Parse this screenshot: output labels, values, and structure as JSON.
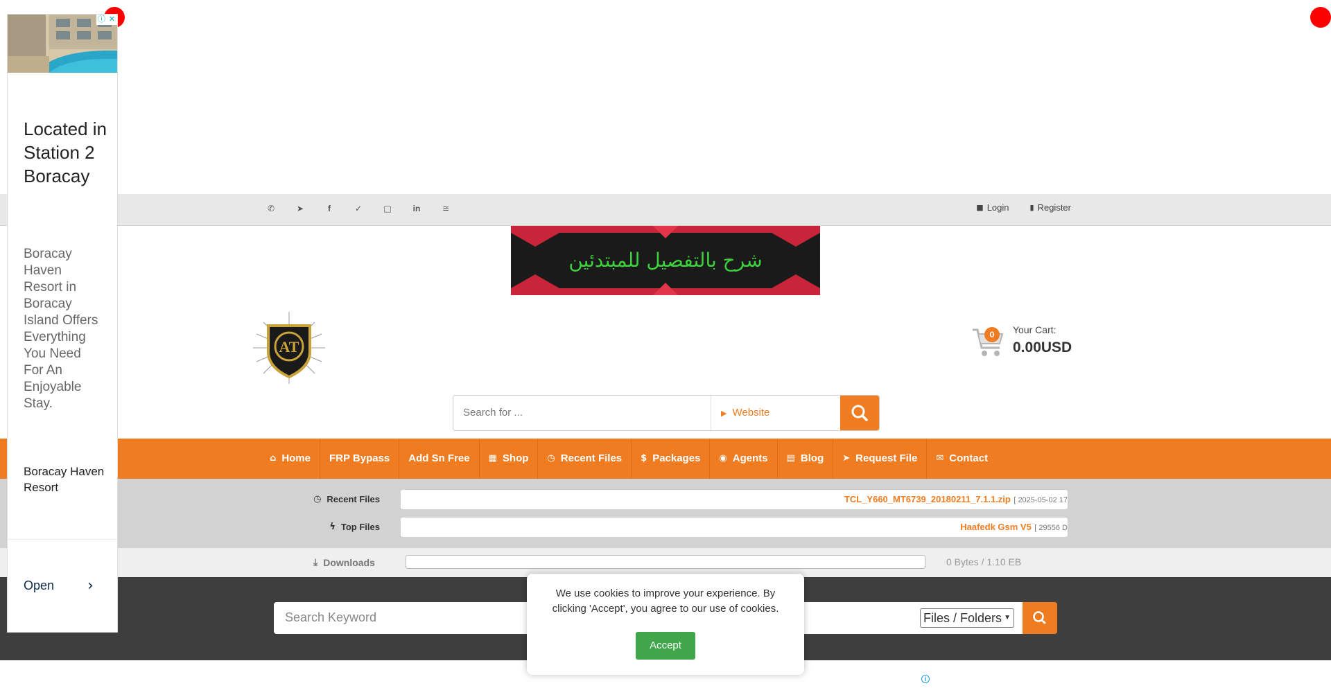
{
  "side_ad": {
    "title": "Located in Station 2 Boracay",
    "description": "Boracay Haven Resort in Boracay Island Offers Everything You Need For An Enjoyable Stay.",
    "brand": "Boracay Haven Resort",
    "cta": "Open",
    "adchoices_icon": "info-icon",
    "close_icon": "close-icon",
    "chevron_icon": "chevron-right-icon"
  },
  "topbar": {
    "social_icons": [
      "whatsapp-icon",
      "telegram-icon",
      "facebook-icon",
      "twitter-icon",
      "instagram-icon",
      "linkedin-icon",
      "rss-icon"
    ],
    "login": "Login",
    "register": "Register"
  },
  "banner": {
    "text": "شرح بالتفصيل للمبتدئين"
  },
  "cart": {
    "count": "0",
    "label": "Your Cart:",
    "amount": "0.00USD"
  },
  "header_search": {
    "placeholder": "Search for ...",
    "scope": "Website"
  },
  "nav": {
    "items": [
      {
        "label": "Home",
        "icon": "home-icon"
      },
      {
        "label": "FRP Bypass",
        "icon": ""
      },
      {
        "label": "Add Sn Free",
        "icon": ""
      },
      {
        "label": "Shop",
        "icon": "cart-icon"
      },
      {
        "label": "Recent Files",
        "icon": "clock-icon"
      },
      {
        "label": "Packages",
        "icon": "dollar-icon"
      },
      {
        "label": "Agents",
        "icon": "globe-icon"
      },
      {
        "label": "Blog",
        "icon": "file-icon"
      },
      {
        "label": "Request File",
        "icon": "paper-plane-icon"
      },
      {
        "label": "Contact",
        "icon": "envelope-icon"
      }
    ]
  },
  "ticker": {
    "recent_label": "Recent Files",
    "recent_name": "TCL_Y660_MT6739_20180211_7.1.1.zip",
    "recent_meta": "[ 2025-05-02 17",
    "top_label": "Top Files",
    "top_name": "Haafedk Gsm V5",
    "top_meta": "[ 29556 D"
  },
  "downloads": {
    "label": "Downloads",
    "progress": 0,
    "value": "0 Bytes / 1.10 EB"
  },
  "footer_search": {
    "placeholder": "Search Keyword",
    "filter": "Files / Folders"
  },
  "cookie": {
    "message": "We use cookies to improve your experience. By clicking 'Accept', you agree to our use of cookies.",
    "accept": "Accept"
  },
  "colors": {
    "accent": "#f07c22",
    "accept_green": "#3fa64a"
  }
}
